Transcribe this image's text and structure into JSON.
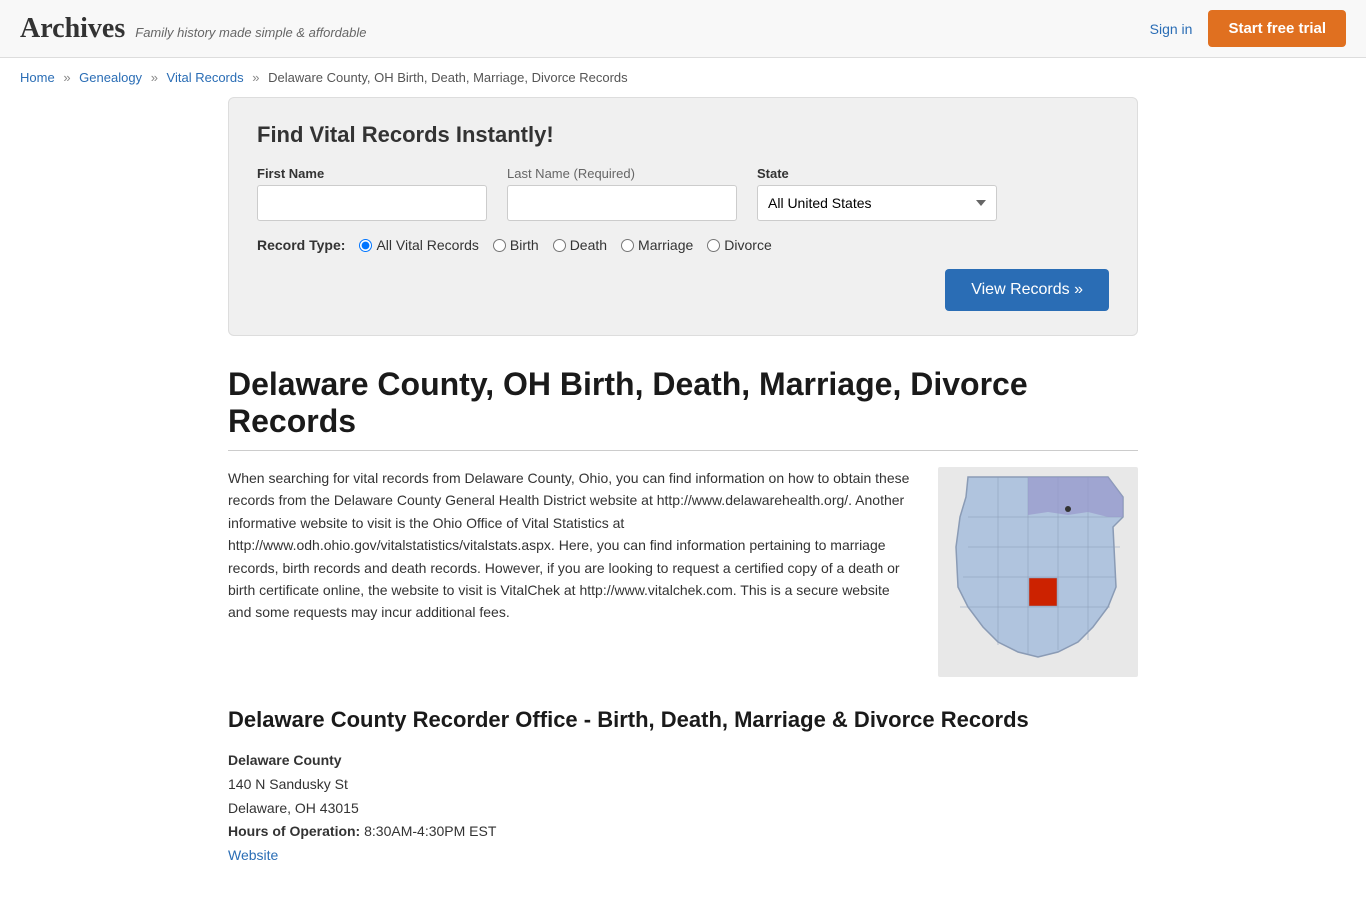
{
  "header": {
    "logo": "Archives",
    "tagline": "Family history made simple & affordable",
    "sign_in": "Sign in",
    "start_trial": "Start free trial"
  },
  "breadcrumb": {
    "home": "Home",
    "genealogy": "Genealogy",
    "vital_records": "Vital Records",
    "current": "Delaware County, OH Birth, Death, Marriage, Divorce Records"
  },
  "search": {
    "title": "Find Vital Records Instantly!",
    "first_name_label": "First Name",
    "last_name_label": "Last Name",
    "last_name_required": "(Required)",
    "state_label": "State",
    "state_default": "All United States",
    "record_type_label": "Record Type:",
    "record_types": [
      "All Vital Records",
      "Birth",
      "Death",
      "Marriage",
      "Divorce"
    ],
    "view_records_btn": "View Records »"
  },
  "page": {
    "title": "Delaware County, OH Birth, Death, Marriage, Divorce Records",
    "description": "When searching for vital records from Delaware County, Ohio, you can find information on how to obtain these records from the Delaware County General Health District website at http://www.delawarehealth.org/. Another informative website to visit is the Ohio Office of Vital Statistics at http://www.odh.ohio.gov/vitalstatistics/vitalstats.aspx. Here, you can find information pertaining to marriage records, birth records and death records. However, if you are looking to request a certified copy of a death or birth certificate online, the website to visit is VitalChek at http://www.vitalchek.com. This is a secure website and some requests may incur additional fees.",
    "recorder_title": "Delaware County Recorder Office - Birth, Death, Marriage & Divorce Records",
    "office_name": "Delaware County",
    "address_line1": "140 N Sandusky St",
    "address_line2": "Delaware, OH 43015",
    "hours_label": "Hours of Operation:",
    "hours": "8:30AM-4:30PM EST",
    "website_label": "Website"
  }
}
